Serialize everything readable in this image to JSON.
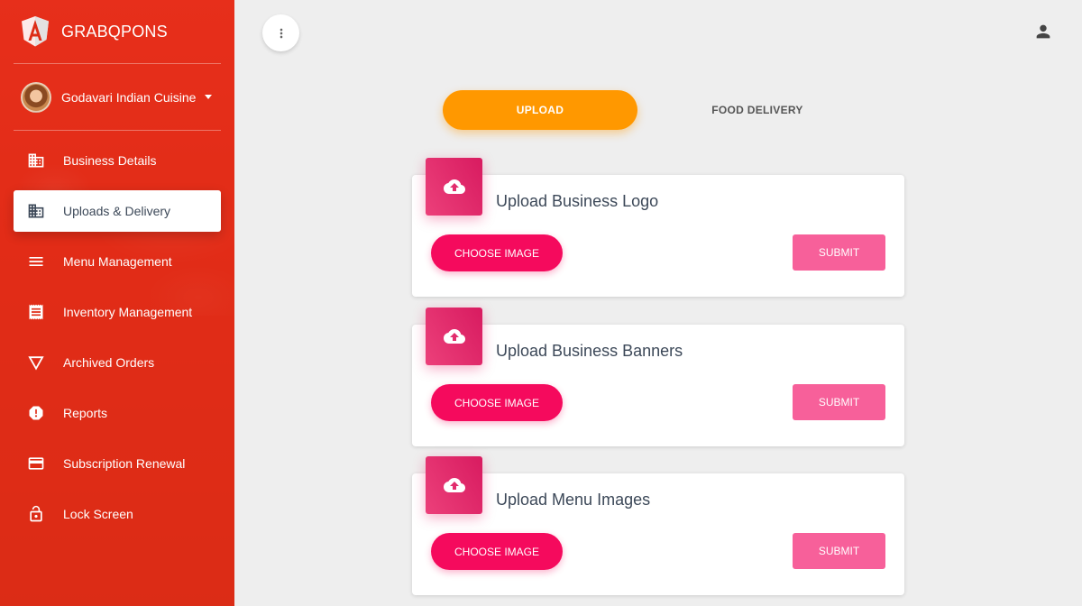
{
  "brand": {
    "name": "GRABQPONS",
    "logo_icon": "angular-logo-icon"
  },
  "user": {
    "name": "Godavari Indian Cuisine"
  },
  "sidebar": {
    "items": [
      {
        "label": "Business Details",
        "icon": "building-icon",
        "active": false
      },
      {
        "label": "Uploads & Delivery",
        "icon": "building-icon",
        "active": true
      },
      {
        "label": "Menu Management",
        "icon": "menu-lines-icon",
        "active": false
      },
      {
        "label": "Inventory Management",
        "icon": "receipt-icon",
        "active": false
      },
      {
        "label": "Archived Orders",
        "icon": "triangle-down-icon",
        "active": false
      },
      {
        "label": "Reports",
        "icon": "alert-icon",
        "active": false
      },
      {
        "label": "Subscription Renewal",
        "icon": "credit-card-icon",
        "active": false
      },
      {
        "label": "Lock Screen",
        "icon": "lock-icon",
        "active": false
      }
    ]
  },
  "tabs": {
    "upload": "UPLOAD",
    "food_delivery": "FOOD DELIVERY"
  },
  "cards": [
    {
      "title": "Upload Business Logo",
      "choose": "CHOOSE IMAGE",
      "submit": "SUBMIT"
    },
    {
      "title": "Upload Business Banners",
      "choose": "CHOOSE IMAGE",
      "submit": "SUBMIT"
    },
    {
      "title": "Upload Menu Images",
      "choose": "CHOOSE IMAGE",
      "submit": "SUBMIT"
    }
  ],
  "colors": {
    "sidebar": "#e52d19",
    "accent_orange": "#ff9800",
    "pink": "#f50a5d",
    "pink_light": "#f7609a"
  }
}
